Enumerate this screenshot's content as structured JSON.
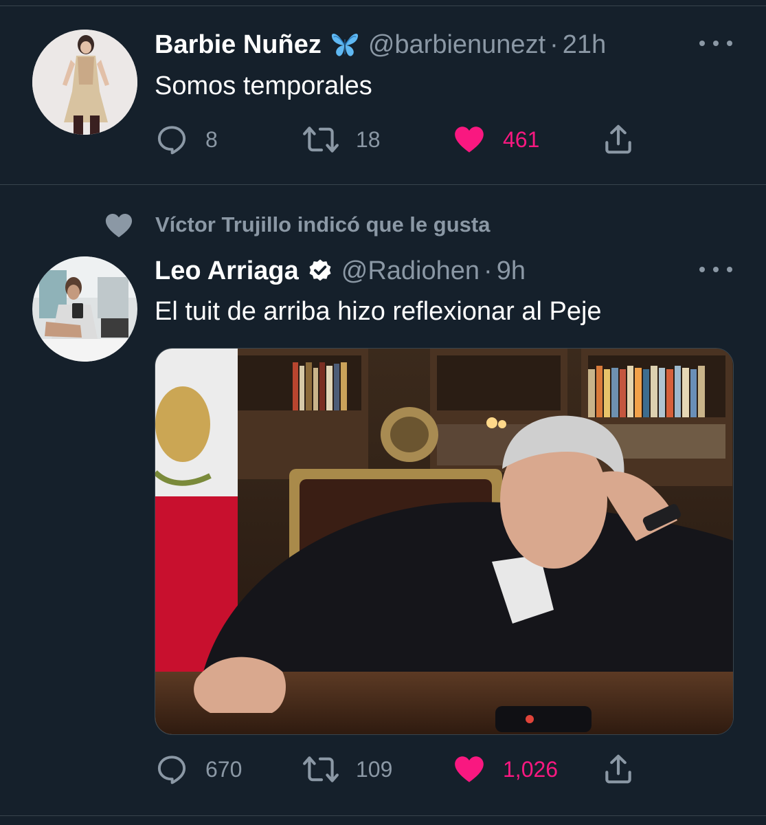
{
  "tweets": [
    {
      "name": "Barbie Nuñez",
      "badge": "butterfly-emoji",
      "handle": "@barbienunezt",
      "separator": "·",
      "time": "21h",
      "text": "Somos temporales",
      "replies": "8",
      "retweets": "18",
      "likes": "461"
    },
    {
      "social_context": "Víctor Trujillo indicó que le gusta",
      "name": "Leo Arriaga",
      "badge": "verified-badge",
      "handle": "@Radiohen",
      "separator": "·",
      "time": "9h",
      "text": "El tuit de arriba hizo reflexionar al Peje",
      "replies": "670",
      "retweets": "109",
      "likes": "1,026"
    }
  ],
  "colors": {
    "background": "#15202b",
    "divider": "#38444d",
    "secondary_text": "#8b98a5",
    "like_pink": "#f91880",
    "verified_blue": "#ffffff"
  }
}
